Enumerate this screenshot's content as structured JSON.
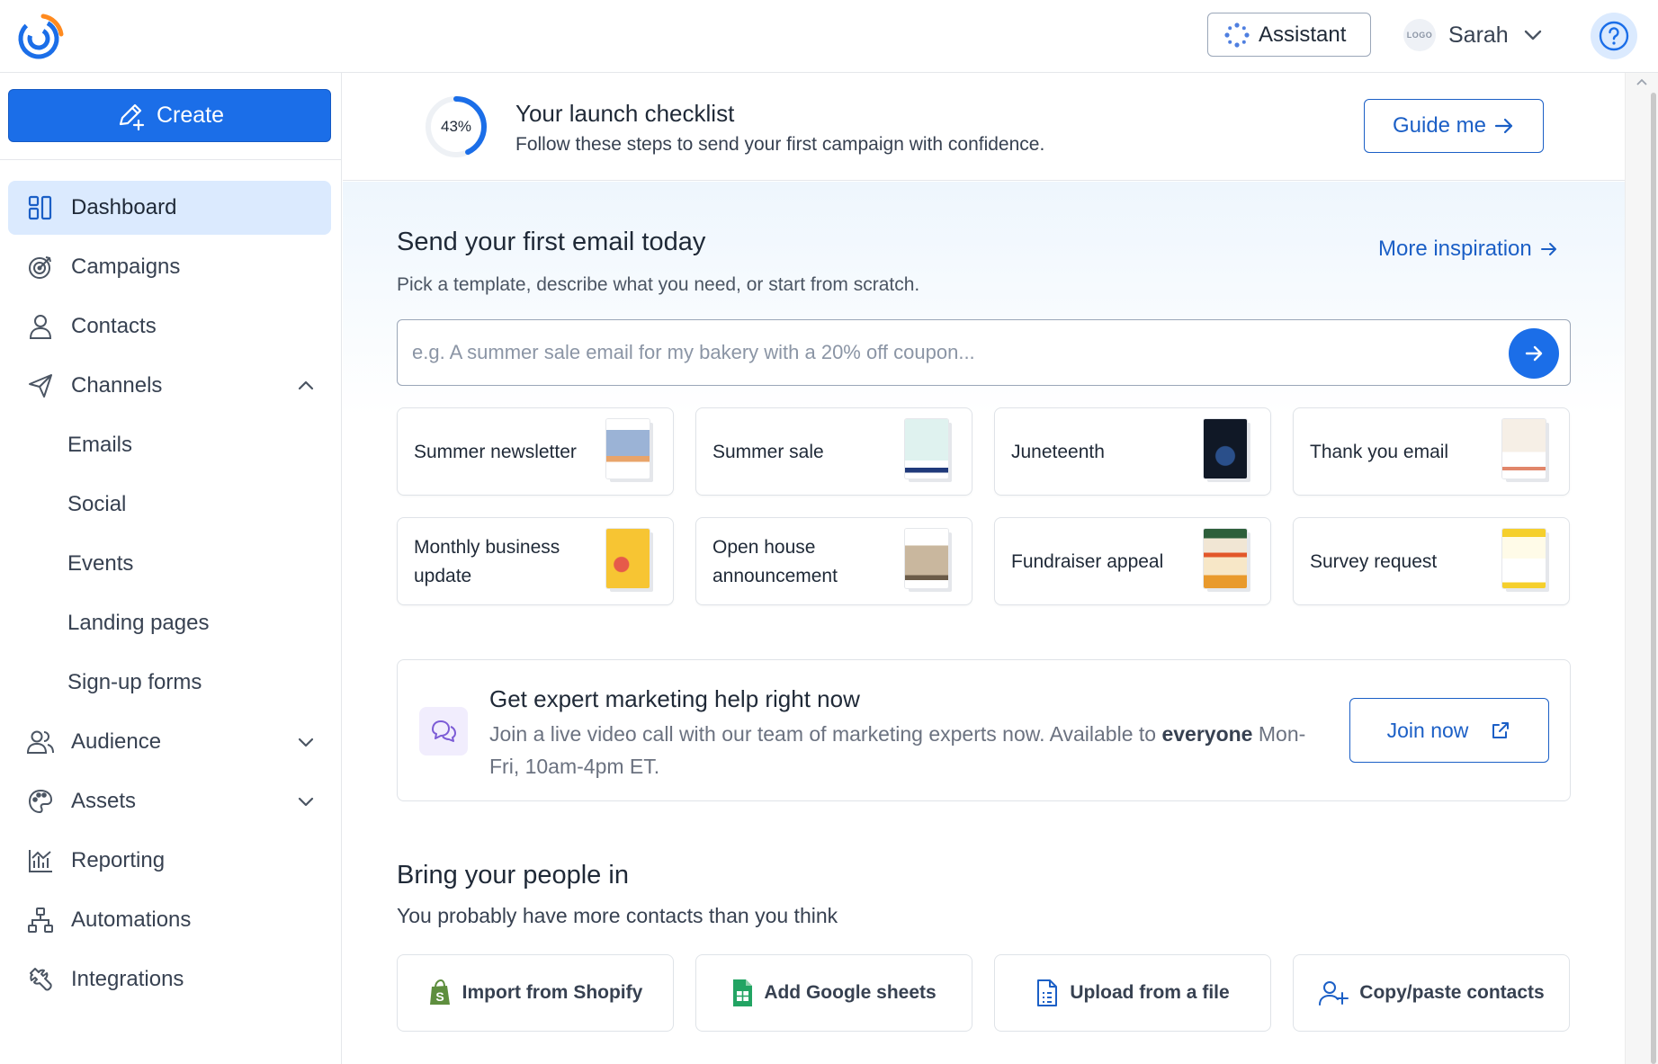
{
  "header": {
    "assistant_label": "Assistant",
    "avatar_text": "LOGO",
    "user_name": "Sarah"
  },
  "sidebar": {
    "create_label": "Create",
    "items": [
      {
        "label": "Dashboard",
        "icon": "dashboard-icon",
        "active": true
      },
      {
        "label": "Campaigns",
        "icon": "target-icon"
      },
      {
        "label": "Contacts",
        "icon": "person-icon"
      },
      {
        "label": "Channels",
        "icon": "paper-plane-icon",
        "expanded": true
      },
      {
        "label": "Audience",
        "icon": "people-icon",
        "expanded": false
      },
      {
        "label": "Assets",
        "icon": "palette-icon",
        "expanded": false
      },
      {
        "label": "Reporting",
        "icon": "bar-chart-icon"
      },
      {
        "label": "Automations",
        "icon": "flowchart-icon"
      },
      {
        "label": "Integrations",
        "icon": "wrench-icon"
      }
    ],
    "channels_sub": [
      "Emails",
      "Social",
      "Events",
      "Landing pages",
      "Sign-up forms"
    ]
  },
  "checklist": {
    "progress_label": "43%",
    "progress_value": 0.43,
    "title": "Your launch checklist",
    "subtitle": "Follow these steps to send your first campaign with confidence.",
    "guide_label": "Guide me"
  },
  "first_email": {
    "title": "Send your first email today",
    "subtitle": "Pick a template, describe what you need, or start from scratch.",
    "more_label": "More inspiration",
    "prompt_placeholder": "e.g. A summer sale email for my bakery with a 20% off coupon...",
    "templates": [
      {
        "label": "Summer newsletter"
      },
      {
        "label": "Summer sale"
      },
      {
        "label": "Juneteenth"
      },
      {
        "label": "Thank you email"
      },
      {
        "label": "Monthly business update"
      },
      {
        "label": "Open house announcement"
      },
      {
        "label": "Fundraiser appeal"
      },
      {
        "label": "Survey request"
      }
    ]
  },
  "expert": {
    "title": "Get expert marketing help right now",
    "text_before": "Join a live video call with our team of marketing experts now. Available to ",
    "text_bold": "everyone",
    "text_after": " Mon-Fri, 10am-4pm ET.",
    "join_label": "Join now"
  },
  "people": {
    "title": "Bring your people in",
    "subtitle": "You probably have more contacts than you think",
    "imports": [
      {
        "label": "Import from Shopify",
        "icon": "shopify-bag-icon"
      },
      {
        "label": "Add Google sheets",
        "icon": "google-sheets-icon"
      },
      {
        "label": "Upload from a file",
        "icon": "file-icon"
      },
      {
        "label": "Copy/paste contacts",
        "icon": "add-person-icon"
      }
    ]
  },
  "colors": {
    "primary": "#1b6ee8",
    "link": "#1b5fc6",
    "active_nav_bg": "#dbeafe"
  }
}
